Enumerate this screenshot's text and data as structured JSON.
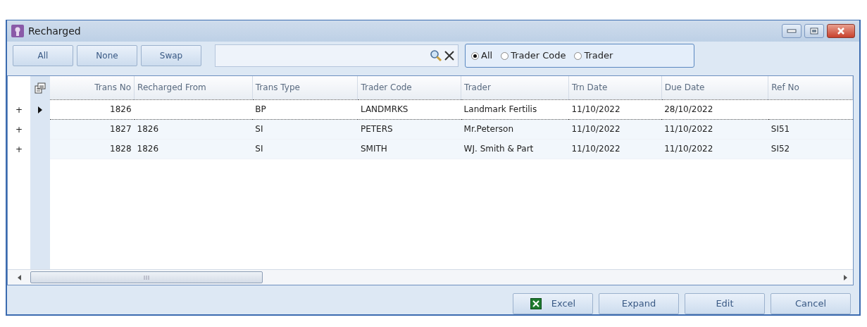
{
  "window": {
    "title": "Recharged"
  },
  "toolbar": {
    "buttons": [
      "All",
      "None",
      "Swap"
    ],
    "search_options": [
      {
        "label": "All",
        "selected": true
      },
      {
        "label": "Trader Code",
        "selected": false
      },
      {
        "label": "Trader",
        "selected": false
      }
    ]
  },
  "table": {
    "columns": [
      "Trans No",
      "Recharged From",
      "Trans Type",
      "Trader Code",
      "Trader",
      "Trn Date",
      "Due Date",
      "Ref No"
    ],
    "rows": [
      {
        "expander": "+",
        "selected": true,
        "cells": [
          "1826",
          "",
          "BP",
          "LANDMRKS",
          "Landmark Fertilis",
          "11/10/2022",
          "28/10/2022",
          ""
        ]
      },
      {
        "expander": "+",
        "selected": false,
        "cells": [
          "1827",
          "1826",
          "SI",
          "PETERS",
          "Mr.Peterson",
          "11/10/2022",
          "11/10/2022",
          "SI51"
        ]
      },
      {
        "expander": "+",
        "selected": false,
        "cells": [
          "1828",
          "1826",
          "SI",
          "SMITH",
          "WJ. Smith & Part",
          "11/10/2022",
          "11/10/2022",
          "SI52"
        ]
      }
    ]
  },
  "footer": {
    "buttons": [
      {
        "label": "Excel",
        "kind": "excel"
      },
      {
        "label": "Expand",
        "kind": "plain"
      },
      {
        "label": "Edit",
        "kind": "plain"
      },
      {
        "label": "Cancel",
        "kind": "plain"
      }
    ]
  }
}
